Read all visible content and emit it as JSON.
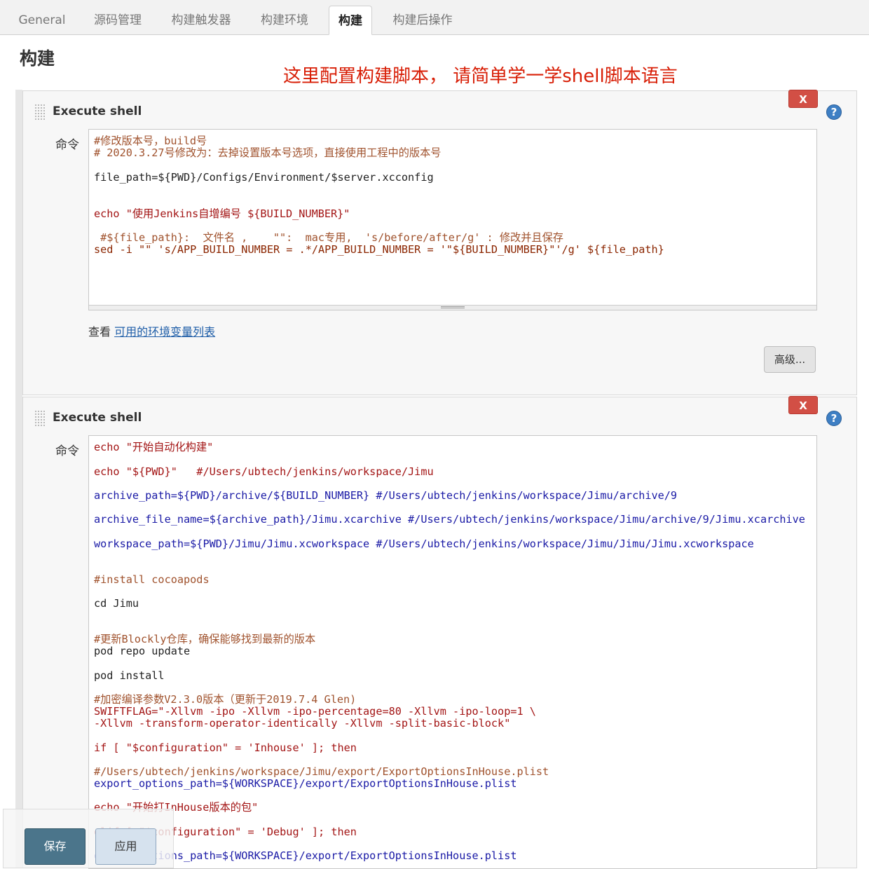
{
  "tabs": [
    {
      "label": "General",
      "active": false
    },
    {
      "label": "源码管理",
      "active": false
    },
    {
      "label": "构建触发器",
      "active": false
    },
    {
      "label": "构建环境",
      "active": false
    },
    {
      "label": "构建",
      "active": true
    },
    {
      "label": "构建后操作",
      "active": false
    }
  ],
  "section_title": "构建",
  "annotation": "这里配置构建脚本， 请简单学一学shell脚本语言",
  "colors": {
    "annotation": "#d81e06",
    "delete_button": "#d24f45",
    "save_button": "#4b758b",
    "link": "#1f5ea8"
  },
  "step1": {
    "title": "Execute shell",
    "delete_label": "X",
    "help_label": "?",
    "command_label": "命令",
    "lines": [
      "#修改版本号，build号",
      "# 2020.3.27号修改为：去掉设置版本号选项，直接使用工程中的版本号",
      "file_path=${PWD}/Configs/Environment/$server.xcconfig",
      "echo \"使用Jenkins自增编号 ${BUILD_NUMBER}\"",
      " #${file_path}:  文件名 ,    \"\":  mac专用,  's/before/after/g' : 修改并且保存",
      "sed -i \"\" 's/APP_BUILD_NUMBER = .*/APP_BUILD_NUMBER = '\"${BUILD_NUMBER}\"'/g' ${file_path}"
    ],
    "env_prefix": "查看",
    "env_link": "可用的环境变量列表",
    "advanced_button": "高级..."
  },
  "step2": {
    "title": "Execute shell",
    "delete_label": "X",
    "help_label": "?",
    "command_label": "命令",
    "lines": [
      "echo \"开始自动化构建\"",
      "echo \"${PWD}\"   #/Users/ubtech/jenkins/workspace/Jimu",
      "archive_path=${PWD}/archive/${BUILD_NUMBER} #/Users/ubtech/jenkins/workspace/Jimu/archive/9",
      "archive_file_name=${archive_path}/Jimu.xcarchive #/Users/ubtech/jenkins/workspace/Jimu/archive/9/Jimu.xcarchive",
      "workspace_path=${PWD}/Jimu/Jimu.xcworkspace #/Users/ubtech/jenkins/workspace/Jimu/Jimu/Jimu.xcworkspace",
      "#install cocoapods",
      "cd Jimu",
      "#更新Blockly仓库，确保能够找到最新的版本",
      "pod repo update",
      "pod install",
      "#加密编译参数V2.3.0版本（更新于2019.7.4 Glen)",
      "SWIFTFLAG=\"-Xllvm -ipo -Xllvm -ipo-percentage=80 -Xllvm -ipo-loop=1 \\",
      "-Xllvm -transform-operator-identically -Xllvm -split-basic-block\"",
      "if [ \"$configuration\" = 'Inhouse' ]; then",
      "#/Users/ubtech/jenkins/workspace/Jimu/export/ExportOptionsInHouse.plist",
      "export_options_path=${WORKSPACE}/export/ExportOptionsInHouse.plist",
      "echo \"开始打InHouse版本的包\"",
      "elif [ \"$configuration\" = 'Debug' ]; then",
      "export_options_path=${WORKSPACE}/export/ExportOptionsInHouse.plist"
    ]
  },
  "footer": {
    "save_label": "保存",
    "apply_label": "应用"
  }
}
